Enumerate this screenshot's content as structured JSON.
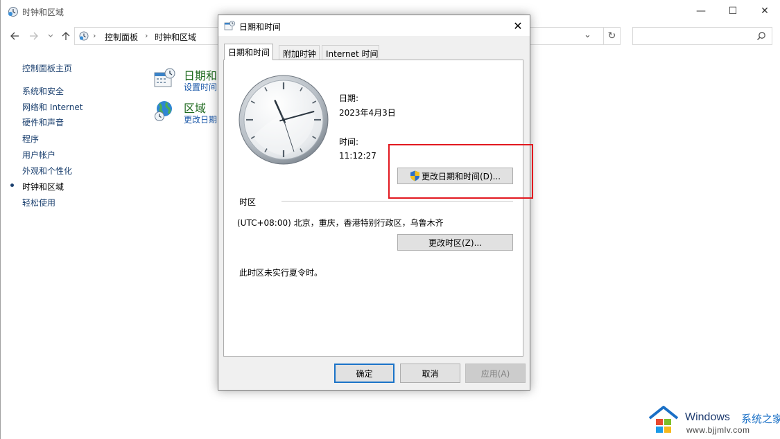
{
  "window": {
    "title": "时钟和区域",
    "minimize_glyph": "—",
    "maximize_glyph": "☐",
    "close_glyph": "✕"
  },
  "address_bar": {
    "crumbs": [
      "控制面板",
      "时钟和区域"
    ],
    "separator": "›",
    "dropdown_glyph": "⌄",
    "refresh_glyph": "↻",
    "search_placeholder": ""
  },
  "sidebar": {
    "home": "控制面板主页",
    "items": [
      {
        "label": "系统和安全"
      },
      {
        "label": "网络和 Internet"
      },
      {
        "label": "硬件和声音"
      },
      {
        "label": "程序"
      },
      {
        "label": "用户帐户"
      },
      {
        "label": "外观和个性化"
      },
      {
        "label": "时钟和区域",
        "current": true
      },
      {
        "label": "轻松使用"
      }
    ]
  },
  "categories": [
    {
      "title": "日期和",
      "subtitle": "设置时间",
      "icon": "calendar-clock-icon"
    },
    {
      "title": "区域",
      "subtitle": "更改日期,",
      "icon": "globe-clock-icon"
    }
  ],
  "dialog": {
    "title": "日期和时间",
    "close_glyph": "✕",
    "tabs": [
      "日期和时间",
      "附加时钟",
      "Internet 时间"
    ],
    "active_tab": "日期和时间",
    "date_label": "日期:",
    "date_value": "2023年4月3日",
    "time_label": "时间:",
    "time_value": "11:12:27",
    "change_datetime_button": "更改日期和时间(D)...",
    "timezone_heading": "时区",
    "timezone_value": "(UTC+08:00) 北京，重庆，香港特别行政区，乌鲁木齐",
    "change_timezone_button": "更改时区(Z)...",
    "dst_note": "此时区未实行夏令时。",
    "ok_button": "确定",
    "cancel_button": "取消",
    "apply_button": "应用(A)"
  },
  "clock": {
    "hours": 11,
    "minutes": 12,
    "seconds": 27
  },
  "colors": {
    "highlight": "#e2181f",
    "link": "#1a57a8",
    "category_title": "#1e6a1e",
    "default_button_border": "#1a73c8"
  },
  "watermark": {
    "brand": "Windows",
    "brand_suffix": "系统之家",
    "url": "www.bjjmlv.com"
  }
}
